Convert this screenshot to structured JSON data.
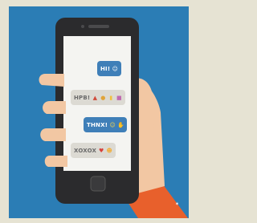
{
  "palette": {
    "frame": "#e6e3d3",
    "background": "#2b7db5",
    "phone": "#2b2b2d",
    "screen": "#f4f4f1",
    "skin": "#f2c7a3",
    "sleeve": "#e8602c",
    "blue_bubble": "#3f7fb8",
    "grey_bubble": "#dcdad3"
  },
  "chat": {
    "messages": [
      {
        "text": "HI!",
        "side": "right",
        "emoji": [
          "smiley-emoji"
        ]
      },
      {
        "text": "HPB!",
        "side": "left",
        "emoji": [
          "party-hat-emoji",
          "balloon-emoji",
          "cake-emoji",
          "gift-emoji"
        ]
      },
      {
        "text": "THNX!",
        "side": "right",
        "emoji": [
          "smiley-emoji",
          "thumbs-up-emoji"
        ]
      },
      {
        "text": "XOXOX",
        "side": "left",
        "emoji": [
          "heart-emoji",
          "kiss-face-emoji"
        ]
      }
    ]
  }
}
